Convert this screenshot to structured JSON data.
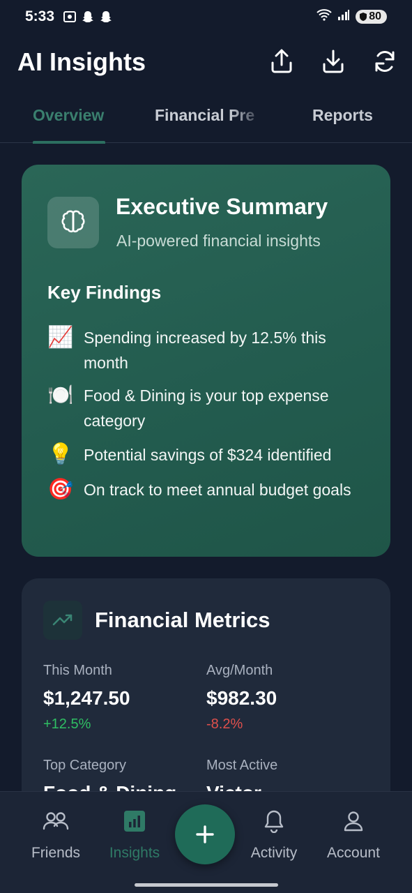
{
  "status_bar": {
    "time": "5:33",
    "battery": "80"
  },
  "header": {
    "title": "AI Insights",
    "actions": [
      "share-icon",
      "download-icon",
      "refresh-icon"
    ]
  },
  "tabs": [
    {
      "label": "Overview",
      "active": true
    },
    {
      "label": "Financial Pre",
      "active": false
    },
    {
      "label": "Reports",
      "active": false
    }
  ],
  "executive_summary": {
    "title": "Executive Summary",
    "subtitle": "AI-powered financial insights",
    "icon": "brain-icon",
    "key_findings_title": "Key Findings",
    "findings": [
      {
        "icon": "📈",
        "text": "Spending increased by 12.5% this month"
      },
      {
        "icon": "🍽️",
        "text": "Food & Dining is your top expense category"
      },
      {
        "icon": "💡",
        "text": "Potential savings of $324 identified"
      },
      {
        "icon": "🎯",
        "text": "On track to meet annual budget goals"
      }
    ]
  },
  "financial_metrics": {
    "title": "Financial Metrics",
    "icon": "trending-up-icon",
    "this_month": {
      "label": "This Month",
      "value": "$1,247.50",
      "change": "+12.5%"
    },
    "avg_month": {
      "label": "Avg/Month",
      "value": "$982.30",
      "change": "-8.2%"
    },
    "top_category": {
      "label": "Top Category",
      "value": "Food & Dining"
    },
    "most_active": {
      "label": "Most Active",
      "value": "Victor"
    }
  },
  "bottom_nav": [
    {
      "label": "Friends",
      "icon": "friends-icon",
      "active": false
    },
    {
      "label": "Insights",
      "icon": "insights-icon",
      "active": true
    },
    {
      "label": "",
      "icon": "plus-icon",
      "active": false
    },
    {
      "label": "Activity",
      "icon": "bell-icon",
      "active": false
    },
    {
      "label": "Account",
      "icon": "user-icon",
      "active": false
    }
  ],
  "colors": {
    "background": "#131b2c",
    "accent": "#2f7a66",
    "card_green": "#235c4f",
    "card_dark": "#202a3b",
    "positive": "#2fbe63",
    "negative": "#e0504c"
  }
}
